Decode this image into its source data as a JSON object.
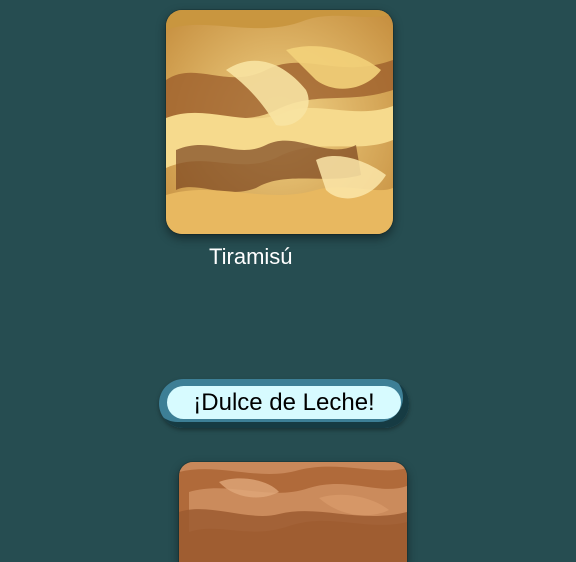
{
  "colors": {
    "background": "#264d51",
    "button_outer": "#3d7f96",
    "button_inner": "#d7fbff",
    "label_text": "#ffffff"
  },
  "flavors": [
    {
      "name": "Tiramisú",
      "image": "tiramisu-ice-cream-photo"
    },
    {
      "image": "dulce-de-leche-ice-cream-photo"
    }
  ],
  "button": {
    "label": "¡Dulce de Leche!"
  }
}
